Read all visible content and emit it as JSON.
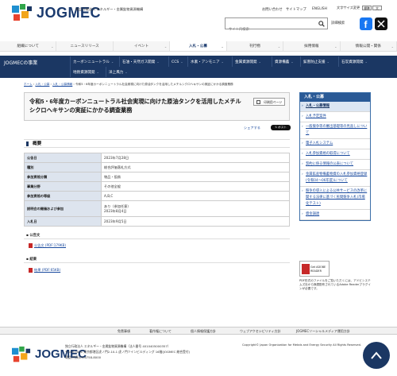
{
  "header": {
    "logo_text": "JOGMEC",
    "org_line1": "独立行政法人 エネルギー・金属鉱物資源機構",
    "util_links": [
      "お問い合わせ",
      "サイトマップ",
      "ENGLISH"
    ],
    "font_size_label": "文字サイズ変更",
    "font_size_options": [
      "標準",
      "大"
    ],
    "search_placeholder": "サイト内検索",
    "detail_search_label": "詳細検索"
  },
  "nav": {
    "items": [
      "組織について",
      "ニュースリリース",
      "イベント",
      "入札・公募",
      "刊行物",
      "採用情報",
      "情報公開・関係"
    ],
    "active_index": 3
  },
  "subnav": {
    "title": "JOGMECの事業",
    "row1": [
      "カーボンニュートラル",
      "石油・天然ガス開発",
      "CCS",
      "水素・アンモニア",
      "金属資源開発",
      "資源備蓄",
      "鉱害防止支援",
      "石炭資源開発"
    ],
    "row2": [
      "地熱資源開発",
      "洋上風力"
    ]
  },
  "breadcrumb": {
    "items": [
      "ホーム",
      "入札・公募",
      "入札・公募情報"
    ],
    "current": "令和5・6年度カーボンニュートラル社会実現に向けた原油タンクを活用したメチルシクロヘキサンの実証にかかる調査業務"
  },
  "page": {
    "title": "令和5・6年度カーボンニュートラル社会実現に向けた原油タンクを活用したメチルシクロヘキサンの実証にかかる調査業務",
    "print_label": "印刷用ページ",
    "share_label": "シェアする",
    "post_label": "ポスト"
  },
  "overview": {
    "heading": "概要",
    "rows": [
      {
        "label": "公告日",
        "value": "2023年7月28日"
      },
      {
        "label": "種別",
        "value": "総合評価落札方式"
      },
      {
        "label": "参加資格分類",
        "value": "物品・役務"
      },
      {
        "label": "事業分野",
        "value": "その他全般"
      },
      {
        "label": "参加資格の等級",
        "value": "A,B,C"
      },
      {
        "label": "説明会の開催および参加",
        "value": "あり（参加任意）\n2023年8月4日"
      },
      {
        "label": "入札日",
        "value": "2023年9月5日"
      }
    ]
  },
  "notice": {
    "heading": "公告文",
    "link": "公告文 (PDF:179KB)"
  },
  "result": {
    "heading": "結果",
    "link": "結果 (PDF:65KB)"
  },
  "sidebar": {
    "heading": "入札・公募",
    "items": [
      "入札・公募情報",
      "入札予定案件",
      "一般競争等の審出基礎等の見直しについて",
      "電子入札システム",
      "入札参加資格の取得について",
      "契約に係る情報の公表について",
      "金属鉱産物備蓄物資の入札参加資格登録(令和04〜06年度)について",
      "競争の導入による公共サービスの改革に関する法律に基づく民間競争入札(市場化テスト)",
      "資金調達"
    ],
    "current_index": 0
  },
  "adobe": {
    "badge": "Get ADOBE READER",
    "note": "PDF形式のファイルをご覧いただくには、アドビシステムズ社から無償配布されているAdobe Readerプラグインが必要です。"
  },
  "footer_nav": [
    "免責事項",
    "著作権について",
    "個人情報保護方針",
    "ウェブアクセシビリティ方針",
    "JOGMECソーシャルメディア運用方針"
  ],
  "footer": {
    "logo_text": "JOGMEC",
    "org": "独立行政法人 エネルギー・金属鉱物資源機構（法人番号 4010405000357）",
    "address": "〒105-0001 東京都港区虎ノ門2-10-1 虎ノ門ツインビルディング 16階(JOGMEC 総合受付)",
    "phone": "電話(代表)03-6758-8000",
    "copyright": "Copyright© Japan Organization for Metals and Energy Security All Rights Reserved."
  }
}
